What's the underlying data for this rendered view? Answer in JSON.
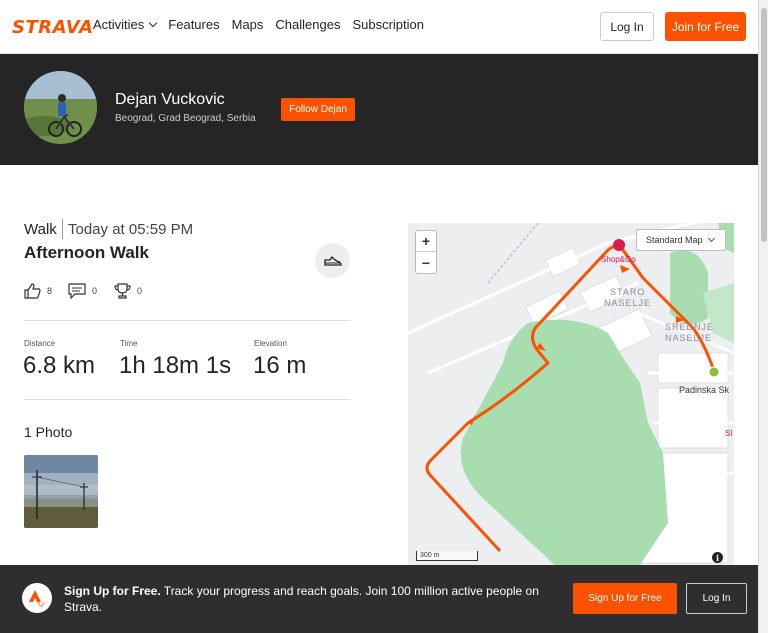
{
  "nav": {
    "logo": "STRAVA",
    "links": [
      "Activities",
      "Features",
      "Maps",
      "Challenges",
      "Subscription"
    ],
    "login": "Log In",
    "join": "Join for Free"
  },
  "athlete": {
    "name": "Dejan Vuckovic",
    "location": "Beograd, Grad Beograd, Serbia",
    "follow": "Follow Dejan"
  },
  "activity": {
    "type": "Walk",
    "time": "Today at 05:59 PM",
    "title": "Afternoon Walk",
    "kudos": "8",
    "comments": "0",
    "achievements": "0",
    "stats": [
      {
        "label": "Distance",
        "value": "6.8 km"
      },
      {
        "label": "Time",
        "value": "1h 18m 1s"
      },
      {
        "label": "Elevation",
        "value": "16 m"
      }
    ],
    "photos_heading": "1 Photo"
  },
  "map": {
    "zoom_in": "+",
    "zoom_out": "−",
    "style_select": "Standard Map",
    "scale": "300 m",
    "info": "i",
    "labels": {
      "shop": "Shop&Go",
      "staro1": "STARO",
      "staro2": "NASELJE",
      "srednje1": "SREDNJE",
      "srednje2": "NASELJE",
      "padinska": "Padinska Sk",
      "edge": "SI"
    },
    "colors": {
      "route": "#fc5200",
      "park": "#a8ddb0",
      "water": "#bfe0ee"
    }
  },
  "banner": {
    "bold": "Sign Up for Free.",
    "text": " Track your progress and reach goals. Join 100 million active people on Strava.",
    "signup": "Sign Up for Free",
    "login": "Log In"
  }
}
